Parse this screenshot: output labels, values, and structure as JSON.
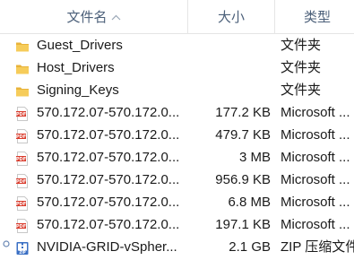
{
  "header": {
    "name_label": "文件名",
    "size_label": "大小",
    "type_label": "类型",
    "sort_indicator": "^"
  },
  "files": [
    {
      "name": "Guest_Drivers",
      "size": "",
      "type": "文件夹",
      "icon": "folder-icon"
    },
    {
      "name": "Host_Drivers",
      "size": "",
      "type": "文件夹",
      "icon": "folder-icon"
    },
    {
      "name": "Signing_Keys",
      "size": "",
      "type": "文件夹",
      "icon": "folder-icon"
    },
    {
      "name": "570.172.07-570.172.0...",
      "size": "177.2 KB",
      "type": "Microsoft ...",
      "icon": "pdf-icon"
    },
    {
      "name": "570.172.07-570.172.0...",
      "size": "479.7 KB",
      "type": "Microsoft ...",
      "icon": "pdf-icon"
    },
    {
      "name": "570.172.07-570.172.0...",
      "size": "3 MB",
      "type": "Microsoft ...",
      "icon": "pdf-icon"
    },
    {
      "name": "570.172.07-570.172.0...",
      "size": "956.9 KB",
      "type": "Microsoft ...",
      "icon": "pdf-icon"
    },
    {
      "name": "570.172.07-570.172.0...",
      "size": "6.8 MB",
      "type": "Microsoft ...",
      "icon": "pdf-icon"
    },
    {
      "name": "570.172.07-570.172.0...",
      "size": "197.1 KB",
      "type": "Microsoft ...",
      "icon": "pdf-icon"
    },
    {
      "name": "NVIDIA-GRID-vSpher...",
      "size": "2.1 GB",
      "type": "ZIP 压缩文件",
      "icon": "zip-icon"
    }
  ],
  "colors": {
    "header_text": "#4c607a",
    "folder": "#f3c34f",
    "pdf": "#d93a2b",
    "zip": "#3a6fc4"
  }
}
